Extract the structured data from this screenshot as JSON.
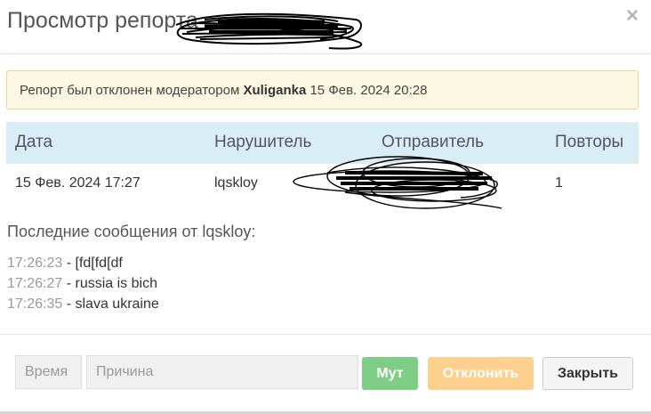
{
  "modal": {
    "title": "Просмотр репорта",
    "close_symbol": "×"
  },
  "alert": {
    "prefix": "Репорт был отклонен модератором ",
    "moderator": "Xuliganka",
    "datetime": " 15 Фев. 2024 20:28"
  },
  "table": {
    "headers": {
      "date": "Дата",
      "violator": "Нарушитель",
      "sender": "Отправитель",
      "repeats": "Повторы"
    },
    "rows": [
      {
        "date": "15 Фев. 2024 17:27",
        "violator": "lqskloy",
        "sender": "",
        "repeats": "1"
      }
    ]
  },
  "messages_section": {
    "title": "Последние сообщения от lqskloy:",
    "separator": " - ",
    "items": [
      {
        "time": "17:26:23",
        "text": "[fd[fd[df"
      },
      {
        "time": "17:26:27",
        "text": "russia is bich"
      },
      {
        "time": "17:26:35",
        "text": "slava ukraine"
      }
    ]
  },
  "footer": {
    "time_placeholder": "Время",
    "reason_placeholder": "Причина",
    "mute_label": "Мут",
    "decline_label": "Отклонить",
    "close_label": "Закрыть"
  },
  "colors": {
    "alert_bg": "#fcf8e3",
    "table_header_bg": "#d9edf7",
    "mute_button": "#7fce85",
    "decline_button": "#fdd08e"
  }
}
